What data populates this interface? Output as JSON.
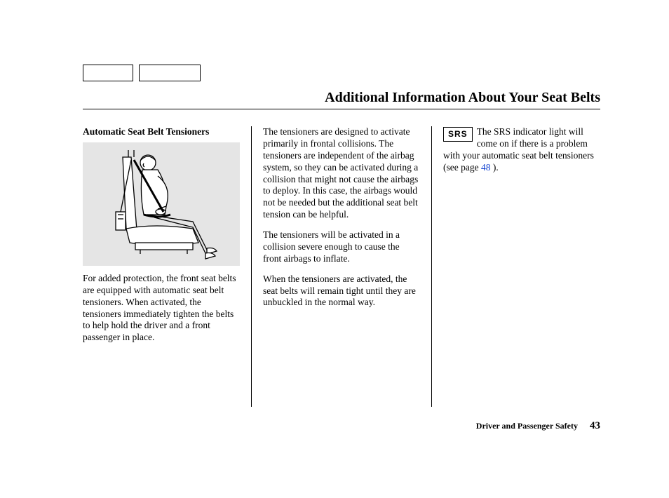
{
  "pageTitle": "Additional Information About Your Seat Belts",
  "col1": {
    "heading": "Automatic Seat Belt Tensioners",
    "p1": "For added protection, the front seat belts are equipped with automatic seat belt tensioners. When activated, the tensioners immediately tighten the belts to help hold the driver and a front passenger in place."
  },
  "col2": {
    "p1": "The tensioners are designed to activate primarily in frontal collisions. The tensioners are independent of the airbag system, so they can be activated during a collision that might not cause the airbags to deploy. In this case, the airbags would not be needed but the additional seat belt tension can be helpful.",
    "p2": "The tensioners will be activated in a collision severe enough to cause the front airbags to inflate.",
    "p3": "When the tensioners are activated, the seat belts will remain tight until they are unbuckled in the normal way."
  },
  "col3": {
    "srsLabel": "SRS",
    "text_before": "The SRS indicator light will come on if there is a problem with your automatic seat belt tensioners (see page ",
    "linkText": "48",
    "text_after": " )."
  },
  "footer": {
    "section": "Driver and Passenger Safety",
    "page": "43"
  }
}
